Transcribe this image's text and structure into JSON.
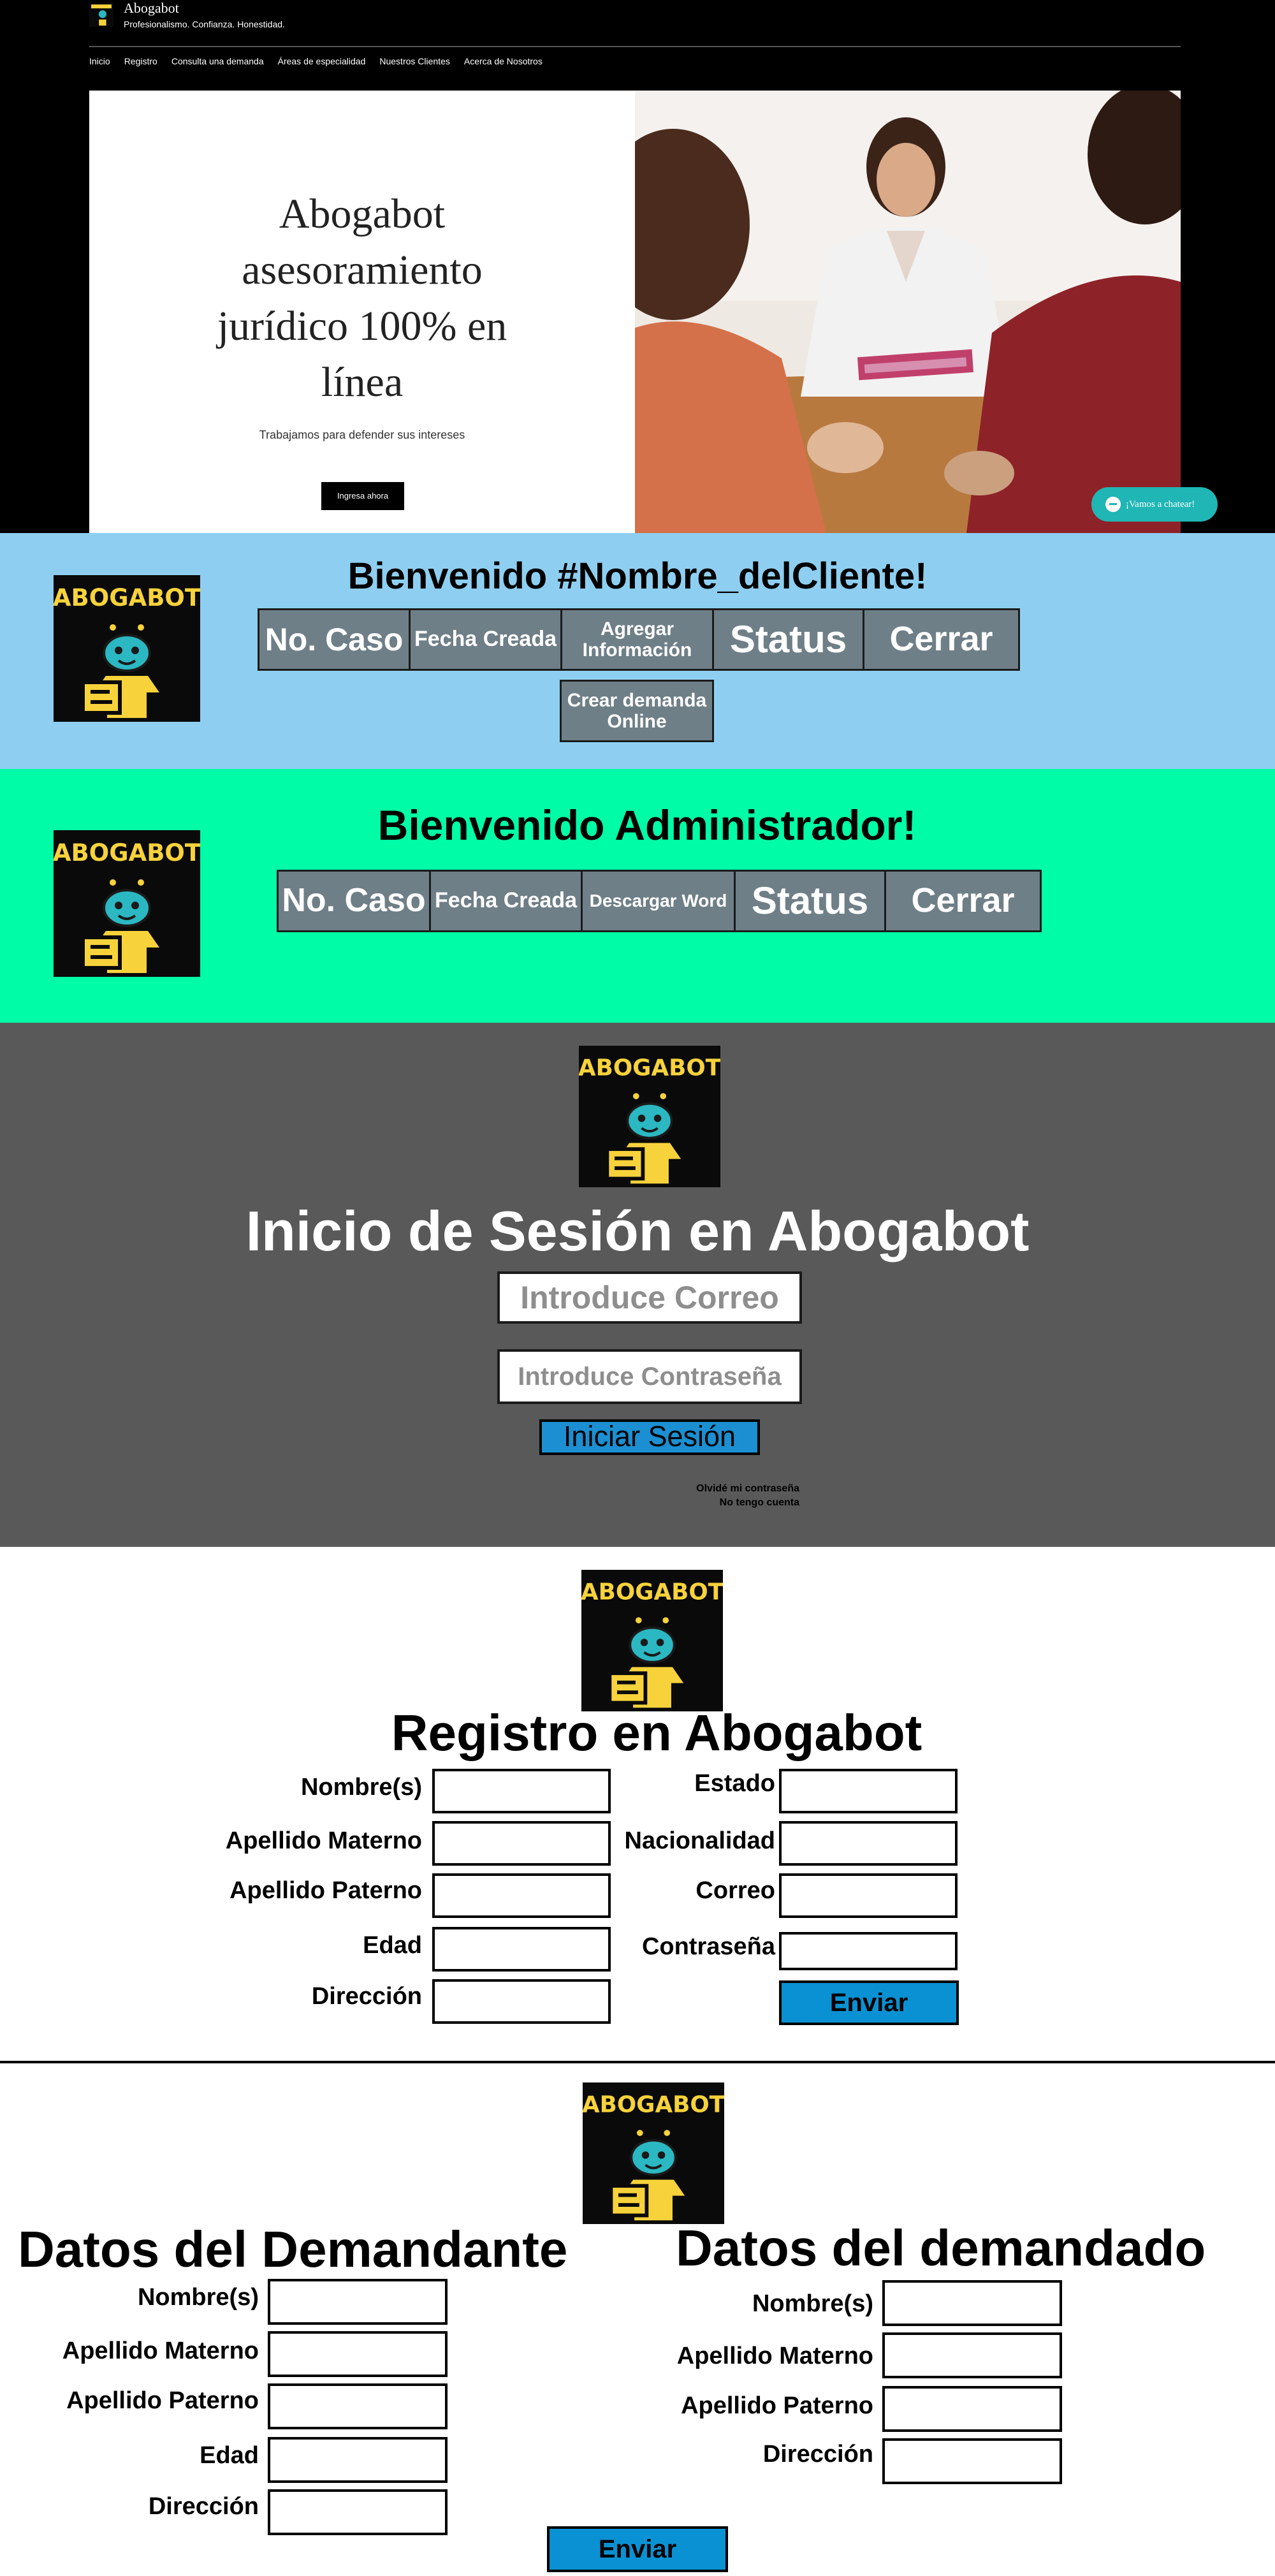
{
  "site": {
    "name": "Abogabot",
    "tagline": "Profesionalismo. Confianza. Honestidad.",
    "nav": [
      "Inicio",
      "Registro",
      "Consulta una demanda",
      "Áreas de especialidad",
      "Nuestros Clientes",
      "Acerca de Nosotros"
    ],
    "hero_title": "Abogabot asesoramiento jurídico 100% en línea",
    "hero_subtitle": "Trabajamos para defender sus intereses",
    "hero_cta": "Ingresa ahora",
    "chat_label": "¡Vamos a chatear!"
  },
  "logo_text": "ABOGABOT",
  "client_panel": {
    "welcome": "Bienvenido #Nombre_delCliente!",
    "columns": [
      "No. Caso",
      "Fecha Creada",
      "Agregar Información",
      "Status",
      "Cerrar"
    ],
    "create_button": "Crear demanda Online"
  },
  "admin_panel": {
    "welcome": "Bienvenido Administrador!",
    "columns": [
      "No. Caso",
      "Fecha Creada",
      "Descargar Word",
      "Status",
      "Cerrar"
    ]
  },
  "login": {
    "title": "Inicio de Sesión en Abogabot",
    "email_placeholder": "Introduce Correo",
    "password_placeholder": "Introduce Contraseña",
    "submit": "Iniciar Sesión",
    "forgot": "Olvidé mi contraseña",
    "no_account": "No tengo cuenta"
  },
  "register": {
    "title": "Registro en Abogabot",
    "left_fields": [
      "Nombre(s)",
      "Apellido Materno",
      "Apellido Paterno",
      "Edad",
      "Dirección"
    ],
    "right_fields": [
      "Estado",
      "Nacionalidad",
      "Correo",
      "Contraseña"
    ],
    "submit": "Enviar"
  },
  "lawsuit": {
    "plaintiff_title": "Datos del Demandante",
    "defendant_title": "Datos del demandado",
    "plaintiff_fields": [
      "Nombre(s)",
      "Apellido Materno",
      "Apellido Paterno",
      "Edad",
      "Dirección"
    ],
    "defendant_fields": [
      "Nombre(s)",
      "Apellido Materno",
      "Apellido Paterno",
      "Dirección"
    ],
    "submit": "Enviar"
  },
  "colors": {
    "client_bg": "#8ecff1",
    "admin_bg": "#00fca6",
    "login_bg": "#595959",
    "button_grey": "#6f7f88",
    "button_blue": "#0a91d3",
    "logo_yellow": "#f7d23b",
    "robot_teal": "#2bb8c2"
  }
}
